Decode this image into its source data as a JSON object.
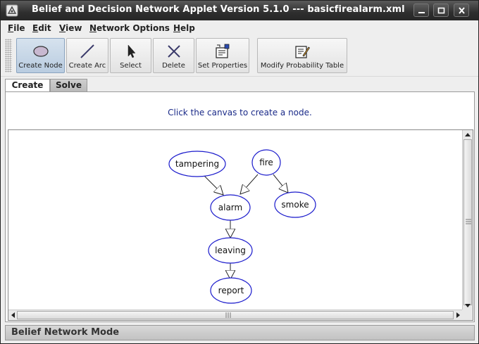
{
  "window": {
    "title": "Belief and Decision Network Applet Version 5.1.0 --- basicfirealarm.xml",
    "controls": [
      "minimize-icon",
      "maximize-icon",
      "close-icon"
    ]
  },
  "menu": {
    "items": [
      {
        "underline": "F",
        "rest": "ile"
      },
      {
        "underline": "E",
        "rest": "dit"
      },
      {
        "underline": "V",
        "rest": "iew"
      },
      {
        "underline": "N",
        "rest": "etwork Options"
      },
      {
        "underline": "H",
        "rest": "elp"
      }
    ]
  },
  "toolbar": {
    "buttons": [
      {
        "label": "Create Node",
        "icon": "ellipse-node-icon",
        "active": true
      },
      {
        "label": "Create Arc",
        "icon": "line-arc-icon",
        "active": false
      },
      {
        "label": "Select",
        "icon": "pointer-arrow-icon",
        "active": false
      },
      {
        "label": "Delete",
        "icon": "x-delete-icon",
        "active": false
      },
      {
        "label": "Set Properties",
        "icon": "properties-icon",
        "active": false
      },
      {
        "label": "Modify Probability Table",
        "icon": "probability-table-icon",
        "active": false
      }
    ]
  },
  "tabs": [
    {
      "label": "Create",
      "active": true
    },
    {
      "label": "Solve",
      "active": false
    }
  ],
  "message": "Click the canvas to create a node.",
  "network": {
    "nodes": [
      "tampering",
      "fire",
      "alarm",
      "smoke",
      "leaving",
      "report"
    ],
    "arcs": [
      {
        "from": "tampering",
        "to": "alarm"
      },
      {
        "from": "fire",
        "to": "alarm"
      },
      {
        "from": "fire",
        "to": "smoke"
      },
      {
        "from": "alarm",
        "to": "leaving"
      },
      {
        "from": "leaving",
        "to": "report"
      }
    ]
  },
  "status": "Belief Network Mode",
  "colors": {
    "node_border": "#1a1acc",
    "message_text": "#1a2a88",
    "active_button": "#b9cce0"
  }
}
